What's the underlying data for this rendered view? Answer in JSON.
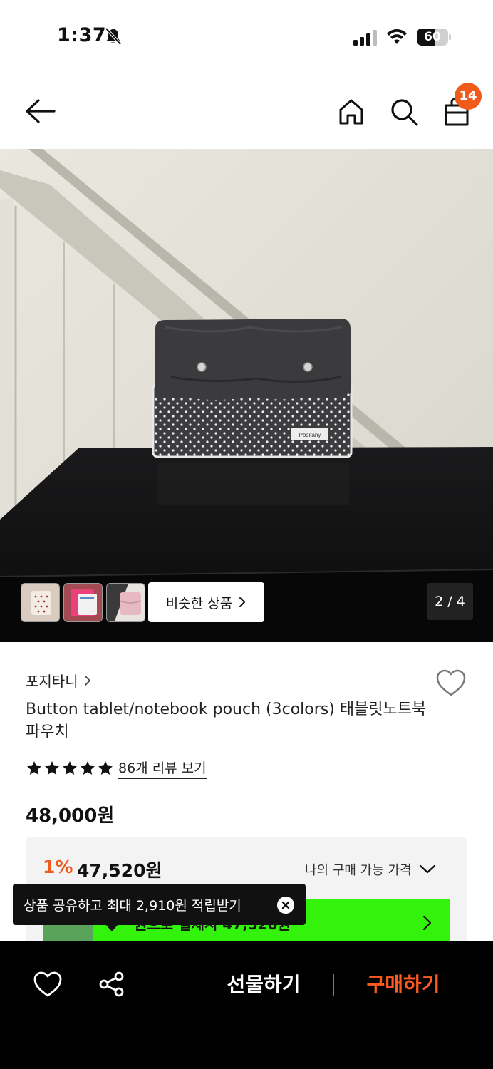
{
  "status_bar": {
    "time": "1:37",
    "battery": "60",
    "battery_level": 0.6
  },
  "nav": {
    "cart_count": "14"
  },
  "gallery": {
    "similar_label": "비슷한 상품",
    "page_indicator": "2 / 4",
    "product_label": "Positany"
  },
  "product": {
    "brand": "포지타니",
    "title": "Button tablet/notebook pouch (3colors) 태블릿노트북파우치",
    "rating_stars": 5,
    "reviews_link": "86개 리뷰 보기",
    "price": "48,000원"
  },
  "discount": {
    "rate": "1%",
    "price": "47,520원",
    "my_price_label": "나의 구매 가능 가격",
    "banner_text": "원으로 결제시 47,520원"
  },
  "tooltip": {
    "text": "상품 공유하고 최대 2,910원 적립받기"
  },
  "bottom_bar": {
    "gift_label": "선물하기",
    "buy_label": "구매하기"
  },
  "colors": {
    "accent": "#f05a1a",
    "buy_text": "#ff5a1f",
    "banner_green": "#33f20b"
  }
}
